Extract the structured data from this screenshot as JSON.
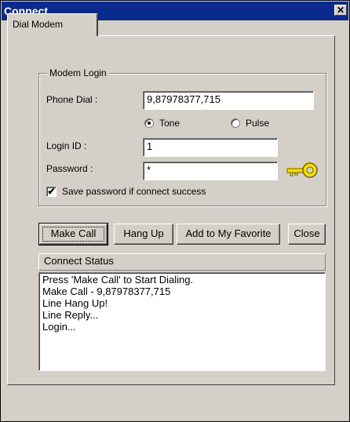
{
  "window": {
    "title": "Connect",
    "close_glyph": "✕"
  },
  "tabs": [
    {
      "label": "Dial Modem",
      "selected": true
    }
  ],
  "modem_login": {
    "group_label": "Modem Login",
    "phone_dial_label": "Phone Dial :",
    "phone_dial_value": "9,87978377,715",
    "tone_label": "Tone",
    "pulse_label": "Pulse",
    "dial_mode_selected": "Tone",
    "login_id_label": "Login ID :",
    "login_id_value": "1",
    "password_label": "Password :",
    "password_value": "*",
    "save_password_label": "Save password if connect success",
    "save_password_checked": true,
    "key_icon": "key-icon"
  },
  "buttons": {
    "make_call": "Make Call",
    "hang_up": "Hang Up",
    "add_favorite": "Add to My Favorite",
    "close": "Close"
  },
  "connect_status": {
    "header": "Connect Status",
    "lines": [
      "Press 'Make Call' to Start Dialing.",
      "Make Call - 9,87978377,715",
      "Line Hang Up!",
      "Line Reply...",
      "Login..."
    ]
  },
  "colors": {
    "title_bar": "#0a2a8e",
    "face": "#d4d0c8",
    "key": "#f0e000"
  }
}
